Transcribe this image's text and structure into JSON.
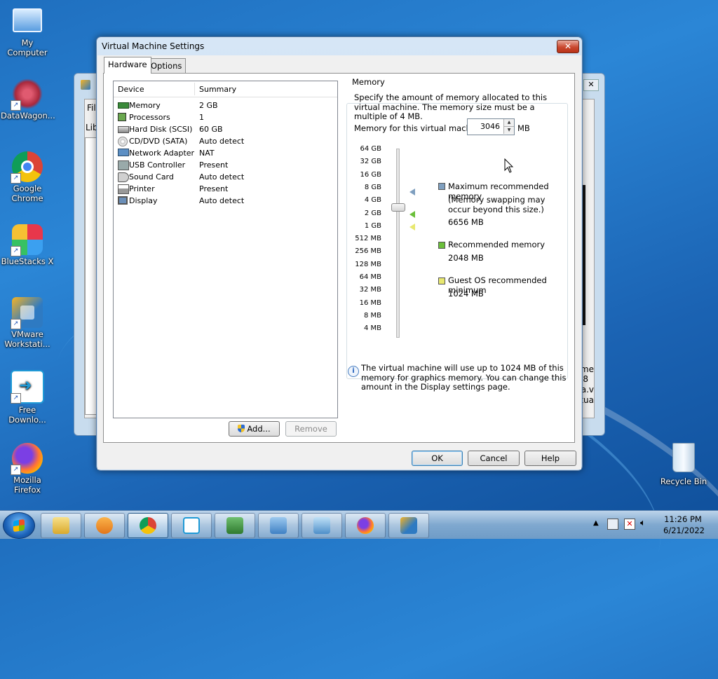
{
  "desktop": {
    "icons": [
      {
        "label": "My Computer"
      },
      {
        "label": "DataWagon..."
      },
      {
        "label": "Google Chrome"
      },
      {
        "label": "BlueStacks X"
      },
      {
        "label": "VMware Workstati..."
      },
      {
        "label": "Free Downlo..."
      },
      {
        "label": "Mozilla Firefox"
      }
    ],
    "recycle_bin": "Recycle Bin"
  },
  "background_window": {
    "menu_partial": "Fil",
    "lib_partial": "Libr",
    "close_glyph": "✕",
    "side_text": [
      "me",
      "8",
      "a.v",
      "tua"
    ]
  },
  "dialog": {
    "title": "Virtual Machine Settings",
    "close_glyph": "✕",
    "tabs": {
      "hardware": "Hardware",
      "options": "Options"
    },
    "device_list": {
      "header": {
        "device": "Device",
        "summary": "Summary"
      },
      "rows": [
        {
          "device": "Memory",
          "summary": "2 GB",
          "icon": "memory-icon"
        },
        {
          "device": "Processors",
          "summary": "1",
          "icon": "processor-icon"
        },
        {
          "device": "Hard Disk (SCSI)",
          "summary": "60 GB",
          "icon": "harddisk-icon"
        },
        {
          "device": "CD/DVD (SATA)",
          "summary": "Auto detect",
          "icon": "cdrom-icon"
        },
        {
          "device": "Network Adapter",
          "summary": "NAT",
          "icon": "network-icon"
        },
        {
          "device": "USB Controller",
          "summary": "Present",
          "icon": "usb-icon"
        },
        {
          "device": "Sound Card",
          "summary": "Auto detect",
          "icon": "sound-icon"
        },
        {
          "device": "Printer",
          "summary": "Present",
          "icon": "printer-icon"
        },
        {
          "device": "Display",
          "summary": "Auto detect",
          "icon": "display-icon"
        }
      ]
    },
    "add_button": "Add...",
    "remove_button": "Remove",
    "memory": {
      "group_label": "Memory",
      "description": "Specify the amount of memory allocated to this virtual machine. The memory size must be a multiple of 4 MB.",
      "field_label": "Memory for this virtual machine:",
      "field_value": "3046",
      "unit": "MB",
      "scale": [
        "64 GB",
        "32 GB",
        "16 GB",
        "8 GB",
        "4 GB",
        "2 GB",
        "1 GB",
        "512 MB",
        "256 MB",
        "128 MB",
        "64 MB",
        "32 MB",
        "16 MB",
        "8 MB",
        "4 MB"
      ],
      "max_recommended": {
        "label": "Maximum recommended memory",
        "note": "(Memory swapping may occur beyond this size.)",
        "value": "6656 MB",
        "color": "#7f9fbf"
      },
      "recommended": {
        "label": "Recommended memory",
        "value": "2048 MB",
        "color": "#6abf3a"
      },
      "guest_min": {
        "label": "Guest OS recommended minimum",
        "value": "1024 MB",
        "color": "#e8e870"
      },
      "info_text": "The virtual machine will use up to 1024 MB of this memory for graphics memory. You can change this amount in the Display settings page."
    },
    "buttons": {
      "ok": "OK",
      "cancel": "Cancel",
      "help": "Help"
    }
  },
  "taskbar": {
    "time": "11:26 PM",
    "date": "6/21/2022"
  }
}
